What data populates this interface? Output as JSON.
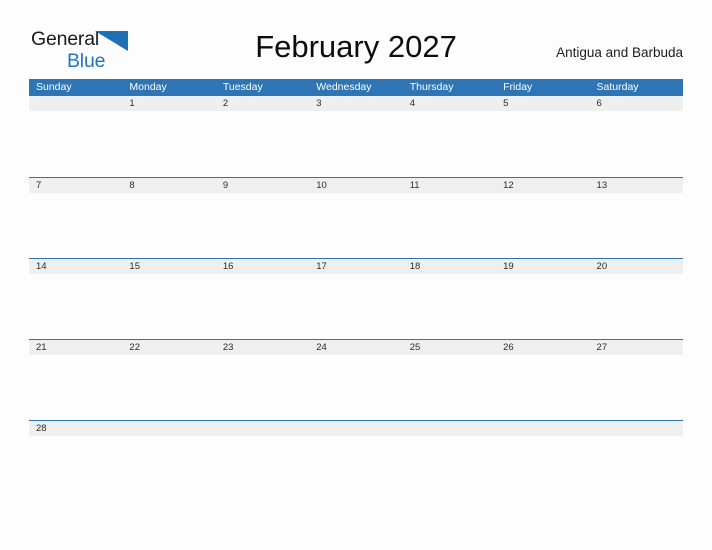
{
  "brand": {
    "name_part_1": "General",
    "name_part_2": "Blue",
    "flag_icon": "blue-triangle-flag",
    "color_primary": "#2077c0",
    "color_text": "#1b1b1b"
  },
  "header": {
    "title": "February 2027",
    "locale": "Antigua and Barbuda"
  },
  "theme": {
    "header_blue": "#2e75b6",
    "date_band_grey": "#efefef",
    "page_background": "#fdfdfd",
    "rule_blue": "#2e75b6"
  },
  "calendar": {
    "month": "February",
    "year": "2027",
    "weekday_headers": [
      "Sunday",
      "Monday",
      "Tuesday",
      "Wednesday",
      "Thursday",
      "Friday",
      "Saturday"
    ],
    "weeks": [
      [
        "",
        "1",
        "2",
        "3",
        "4",
        "5",
        "6"
      ],
      [
        "7",
        "8",
        "9",
        "10",
        "11",
        "12",
        "13"
      ],
      [
        "14",
        "15",
        "16",
        "17",
        "18",
        "19",
        "20"
      ],
      [
        "21",
        "22",
        "23",
        "24",
        "25",
        "26",
        "27"
      ],
      [
        "28",
        "",
        "",
        "",
        "",
        "",
        ""
      ]
    ]
  }
}
